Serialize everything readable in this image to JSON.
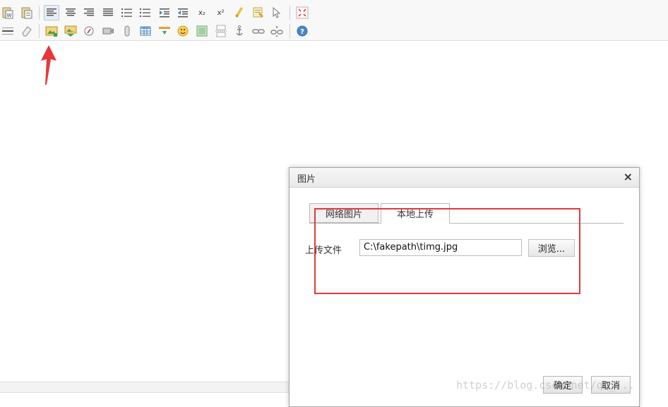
{
  "toolbar": {
    "row1": [
      {
        "name": "paste-word-icon",
        "active": false
      },
      {
        "name": "paste-text-icon",
        "active": false
      },
      {
        "sep": true
      },
      {
        "name": "align-left-icon",
        "active": true
      },
      {
        "name": "align-center-icon",
        "active": false
      },
      {
        "name": "align-right-icon",
        "active": false
      },
      {
        "name": "align-justify-icon",
        "active": false
      },
      {
        "name": "ordered-list-icon",
        "active": false
      },
      {
        "name": "unordered-list-icon",
        "active": false
      },
      {
        "name": "indent-icon",
        "active": false
      },
      {
        "name": "outdent-icon",
        "active": false
      },
      {
        "name": "subscript-icon",
        "active": false,
        "text": "x₂"
      },
      {
        "name": "superscript-icon",
        "active": false,
        "text": "x²"
      },
      {
        "name": "clear-format-icon",
        "active": false
      },
      {
        "name": "format-painter-icon",
        "active": false
      },
      {
        "name": "select-all-icon",
        "active": false
      },
      {
        "sep": true
      },
      {
        "name": "fullscreen-icon",
        "active": false
      }
    ],
    "row2": [
      {
        "name": "horizontal-rule-icon",
        "active": false
      },
      {
        "name": "eraser-icon",
        "active": false
      },
      {
        "sep": true
      },
      {
        "name": "insert-image-icon",
        "active": false
      },
      {
        "name": "insert-multi-image-icon",
        "active": false
      },
      {
        "name": "insert-flash-icon",
        "active": false
      },
      {
        "name": "insert-media-icon",
        "active": false
      },
      {
        "name": "attachment-icon",
        "active": false
      },
      {
        "name": "table-icon",
        "active": false
      },
      {
        "name": "code-icon",
        "active": false
      },
      {
        "name": "emoticon-icon",
        "active": false
      },
      {
        "name": "template-icon",
        "active": false
      },
      {
        "name": "pagebreak-icon",
        "active": false
      },
      {
        "name": "anchor-icon",
        "active": false
      },
      {
        "name": "link-icon",
        "active": false
      },
      {
        "name": "unlink-icon",
        "active": false
      },
      {
        "sep": true
      },
      {
        "name": "help-icon",
        "active": false
      }
    ]
  },
  "dialog": {
    "title": "图片",
    "close": "×",
    "tabs": [
      {
        "label": "网络图片",
        "active": false
      },
      {
        "label": "本地上传",
        "active": true
      }
    ],
    "upload_label": "上传文件",
    "file_value": "C:\\fakepath\\timg.jpg",
    "browse_label": "浏览...",
    "ok_label": "确定",
    "cancel_label": "取消"
  },
  "colors": {
    "annotation_red": "#e4393c"
  },
  "watermark": "https://blog.csdn.net/qq_..."
}
